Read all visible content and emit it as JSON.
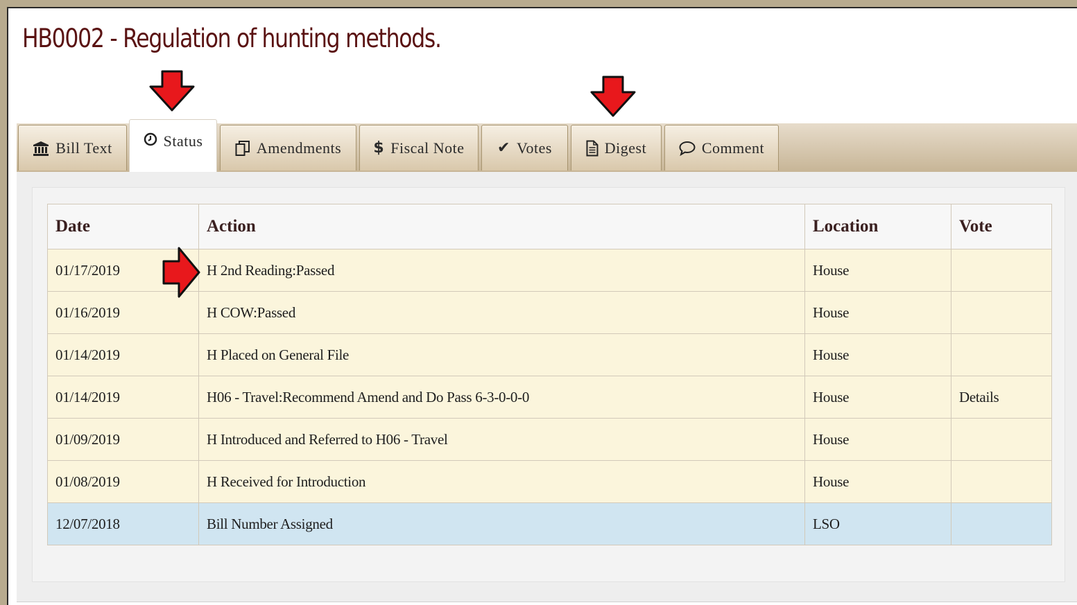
{
  "page_title": "HB0002 - Regulation of hunting methods.",
  "tabs": [
    {
      "label": "Bill Text",
      "icon": "bank-icon"
    },
    {
      "label": "Status",
      "icon": "clock-icon",
      "active": true
    },
    {
      "label": "Amendments",
      "icon": "copy-icon"
    },
    {
      "label": "Fiscal Note",
      "icon": "dollar-icon"
    },
    {
      "label": "Votes",
      "icon": "check-icon"
    },
    {
      "label": "Digest",
      "icon": "document-icon"
    },
    {
      "label": "Comment",
      "icon": "speech-bubble-icon"
    }
  ],
  "status_table": {
    "headers": {
      "date": "Date",
      "action": "Action",
      "location": "Location",
      "vote": "Vote"
    },
    "rows": [
      {
        "date": "01/17/2019",
        "action": "H 2nd Reading:Passed",
        "location": "House",
        "vote": ""
      },
      {
        "date": "01/16/2019",
        "action": "H COW:Passed",
        "location": "House",
        "vote": ""
      },
      {
        "date": "01/14/2019",
        "action": "H Placed on General File",
        "location": "House",
        "vote": ""
      },
      {
        "date": "01/14/2019",
        "action": "H06 - Travel:Recommend Amend and Do Pass 6-3-0-0-0",
        "location": "House",
        "vote": "Details"
      },
      {
        "date": "01/09/2019",
        "action": "H Introduced and Referred to H06 - Travel",
        "location": "House",
        "vote": ""
      },
      {
        "date": "01/08/2019",
        "action": "H Received for Introduction",
        "location": "House",
        "vote": ""
      },
      {
        "date": "12/07/2018",
        "action": "Bill Number Assigned",
        "location": "LSO",
        "vote": ""
      }
    ]
  },
  "annotation_color": "#e8181c",
  "colors": {
    "title": "#5a1212",
    "row_background": "#fbf5dc",
    "row_highlight": "#d0e5f1"
  }
}
